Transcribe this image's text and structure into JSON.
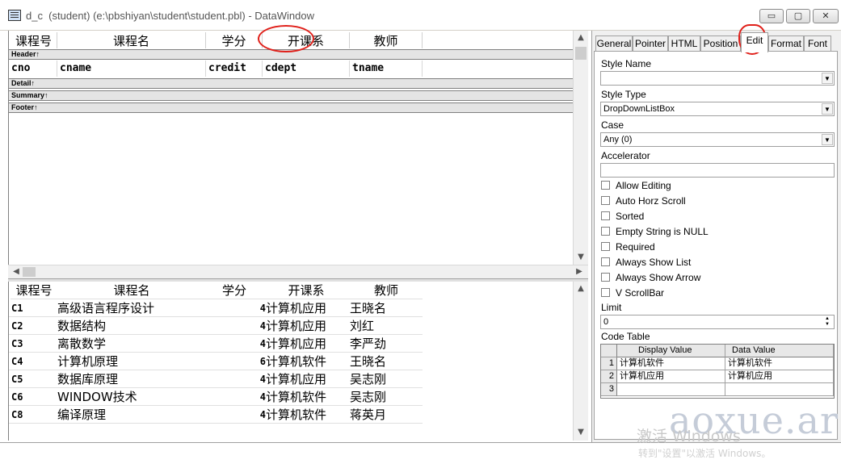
{
  "window": {
    "title": "d_c  (student) (e:\\pbshiyan\\student\\student.pbl) - DataWindow",
    "min_glyph": "▭",
    "max_glyph": "▢",
    "close_glyph": "✕"
  },
  "design": {
    "headers": [
      "课程号",
      "课程名",
      "学分",
      "开课系",
      "教师"
    ],
    "bands": {
      "header": "Header↑",
      "detail": "Detail↑",
      "summary": "Summary↑",
      "footer": "Footer↑"
    },
    "fields": [
      "cno",
      "cname",
      "credit",
      "cdept",
      "tname"
    ]
  },
  "preview": {
    "headers": [
      "课程号",
      "课程名",
      "学分",
      "开课系",
      "教师"
    ],
    "rows": [
      {
        "cno": "C1",
        "cname": "高级语言程序设计",
        "credit": "4",
        "cdept": "计算机应用",
        "tname": "王晓名"
      },
      {
        "cno": "C2",
        "cname": "数据结构",
        "credit": "4",
        "cdept": "计算机应用",
        "tname": "刘红"
      },
      {
        "cno": "C3",
        "cname": "离散数学",
        "credit": "4",
        "cdept": "计算机应用",
        "tname": "李严劲"
      },
      {
        "cno": "C4",
        "cname": "计算机原理",
        "credit": "6",
        "cdept": "计算机软件",
        "tname": "王晓名"
      },
      {
        "cno": "C5",
        "cname": "数据库原理",
        "credit": "4",
        "cdept": "计算机应用",
        "tname": "吴志刚"
      },
      {
        "cno": "C6",
        "cname": "WINDOW技术",
        "credit": "4",
        "cdept": "计算机软件",
        "tname": "吴志刚"
      },
      {
        "cno": "C8",
        "cname": "编译原理",
        "credit": "4",
        "cdept": "计算机软件",
        "tname": "蒋英月"
      }
    ]
  },
  "properties": {
    "tabs": [
      "General",
      "Pointer",
      "HTML",
      "Position",
      "Edit",
      "Format",
      "Font"
    ],
    "active_tab": "Edit",
    "style_name_label": "Style Name",
    "style_name_value": "",
    "style_type_label": "Style Type",
    "style_type_value": "DropDownListBox",
    "case_label": "Case",
    "case_value": "Any (0)",
    "accelerator_label": "Accelerator",
    "accelerator_value": "",
    "checkboxes": [
      {
        "label": "Allow Editing",
        "checked": false
      },
      {
        "label": "Auto Horz Scroll",
        "checked": false
      },
      {
        "label": "Sorted",
        "checked": false
      },
      {
        "label": "Empty String is NULL",
        "checked": false
      },
      {
        "label": "Required",
        "checked": false
      },
      {
        "label": "Always Show List",
        "checked": false
      },
      {
        "label": "Always Show Arrow",
        "checked": false
      },
      {
        "label": "V ScrollBar",
        "checked": false
      }
    ],
    "limit_label": "Limit",
    "limit_value": "0",
    "code_table_label": "Code Table",
    "code_table": {
      "headers": [
        "Display Value",
        "Data Value"
      ],
      "rows": [
        {
          "num": "1",
          "display": "计算机软件",
          "data": "计算机软件"
        },
        {
          "num": "2",
          "display": "计算机应用",
          "data": "计算机应用"
        },
        {
          "num": "3",
          "display": "",
          "data": ""
        }
      ]
    }
  },
  "watermark": {
    "line1": "激活 Windows",
    "line2": "转到\"设置\"以激活 Windows。",
    "site": "aoxue.ar"
  }
}
